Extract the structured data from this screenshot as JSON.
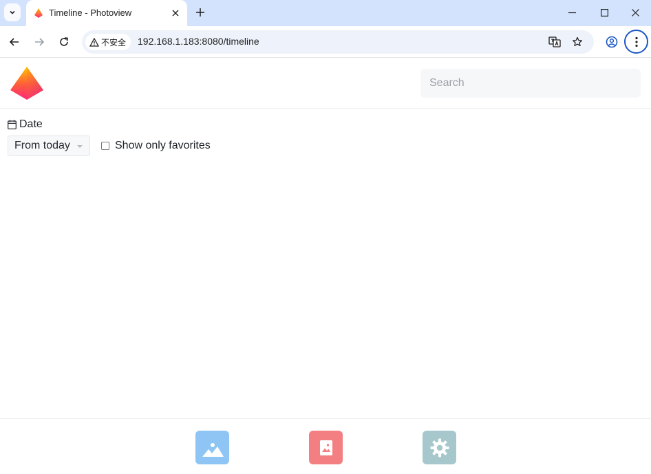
{
  "browser": {
    "tab_title": "Timeline - Photoview",
    "security_label": "不安全",
    "url": "192.168.1.183:8080/timeline"
  },
  "header": {
    "search_placeholder": "Search"
  },
  "filters": {
    "date_label": "Date",
    "date_select_value": "From today",
    "favorites_label": "Show only favorites",
    "favorites_checked": false
  },
  "bottom_nav": {
    "items": [
      {
        "icon": "photos-icon",
        "color": "#8ec5f4"
      },
      {
        "icon": "albums-icon",
        "color": "#f47f82"
      },
      {
        "icon": "settings-icon",
        "color": "#a6c8cc"
      }
    ]
  }
}
